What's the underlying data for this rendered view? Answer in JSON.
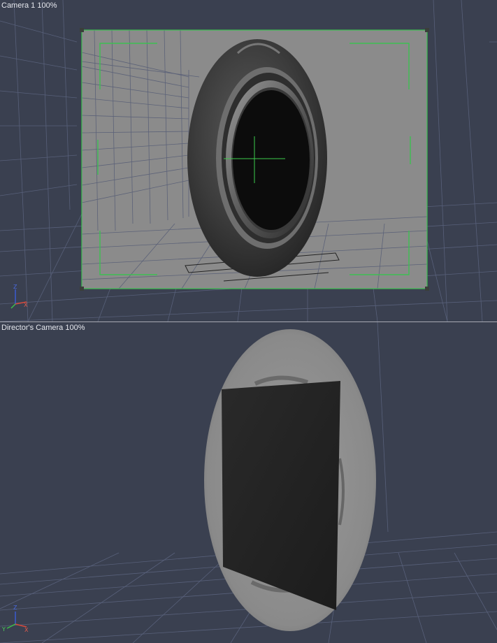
{
  "viewports": {
    "top": {
      "label": "Camera 1 100%"
    },
    "bottom": {
      "label": "Director's Camera 100%"
    }
  },
  "axes": {
    "z_label": "Z",
    "x_label": "X",
    "y_label": "Y"
  },
  "colors": {
    "background": "#3a4050",
    "grid": "#58607a",
    "camera_frame": "#3dbf52",
    "crosshair": "#3dcc4c",
    "axis_z": "#3a5ad0",
    "axis_x": "#d84a3c",
    "axis_y": "#3cbf4a"
  }
}
